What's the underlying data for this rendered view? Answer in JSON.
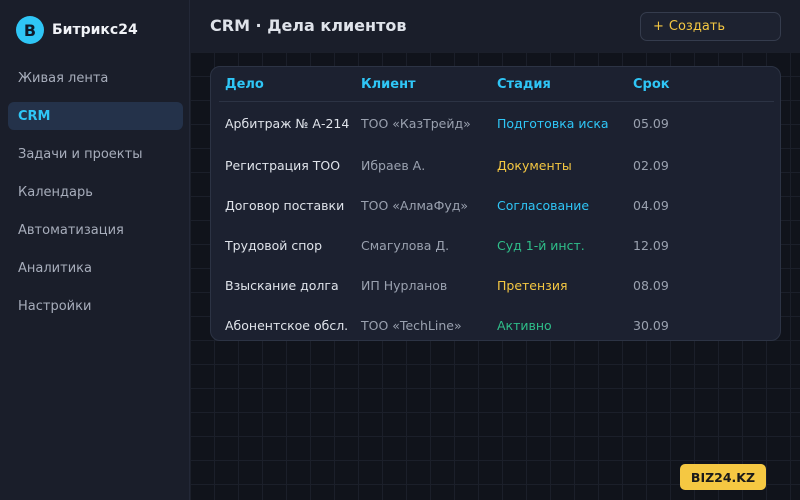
{
  "brand": {
    "logo_letter": "B",
    "name": "Битрикс24",
    "logo_color": "#2fc6f6"
  },
  "sidebar": {
    "items": [
      {
        "label": "Живая лента",
        "active": false
      },
      {
        "label": "CRM",
        "active": true
      },
      {
        "label": "Задачи и проекты",
        "active": false
      },
      {
        "label": "Календарь",
        "active": false
      },
      {
        "label": "Автоматизация",
        "active": false
      },
      {
        "label": "Аналитика",
        "active": false
      },
      {
        "label": "Настройки",
        "active": false
      }
    ]
  },
  "header": {
    "title": "CRM · Дела клиентов",
    "create_icon": "+",
    "create_label": "Создать"
  },
  "table": {
    "columns": [
      "Дело",
      "Клиент",
      "Стадия",
      "Срок"
    ],
    "rows": [
      {
        "case": "Арбитраж № А-214",
        "client": "ТОО «КазТрейд»",
        "stage": "Подготовка иска",
        "stage_color": "#2fc6f6",
        "due": "05.09"
      },
      {
        "case": "Регистрация ТОО",
        "client": "Ибраев А.",
        "stage": "Документы",
        "stage_color": "#f5c842",
        "due": "02.09"
      },
      {
        "case": "Договор поставки",
        "client": "ТОО «АлмаФуд»",
        "stage": "Согласование",
        "stage_color": "#2fc6f6",
        "due": "04.09"
      },
      {
        "case": "Трудовой спор",
        "client": "Смагулова Д.",
        "stage": "Суд 1-й инст.",
        "stage_color": "#2fbf8a",
        "due": "12.09"
      },
      {
        "case": "Взыскание долга",
        "client": "ИП Нурланов",
        "stage": "Претензия",
        "stage_color": "#f5c842",
        "due": "08.09"
      },
      {
        "case": "Абонентское обсл.",
        "client": "ТОО «TechLine»",
        "stage": "Активно",
        "stage_color": "#2fbf8a",
        "due": "30.09"
      }
    ]
  },
  "watermark": {
    "label": "BIZ24.KZ",
    "color": "#f5c842"
  }
}
